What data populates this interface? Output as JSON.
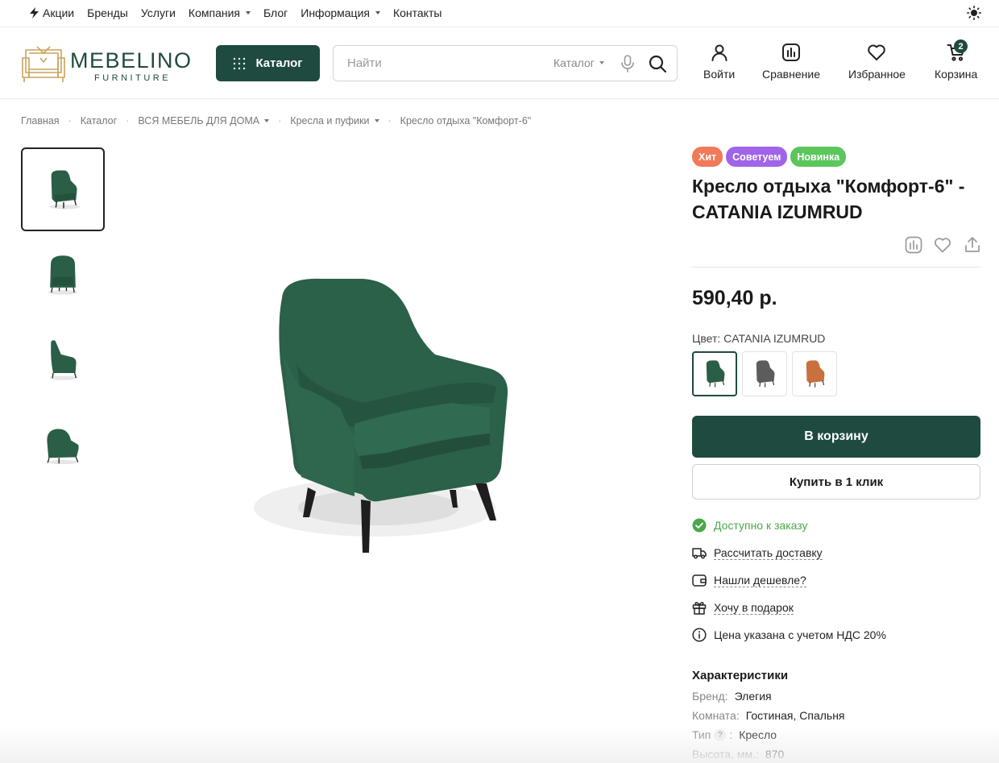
{
  "topnav": {
    "items": [
      {
        "label": "Акции",
        "icon": "lightning-icon"
      },
      {
        "label": "Бренды"
      },
      {
        "label": "Услуги"
      },
      {
        "label": "Компания",
        "has_dropdown": true
      },
      {
        "label": "Блог"
      },
      {
        "label": "Информация",
        "has_dropdown": true
      },
      {
        "label": "Контакты"
      }
    ],
    "theme_icon": "sun-icon"
  },
  "header": {
    "logo": {
      "name": "MEBELINO",
      "subtitle": "FURNITURE"
    },
    "catalog_button": "Каталог",
    "search": {
      "placeholder": "Найти",
      "scope": "Каталог"
    },
    "actions": [
      {
        "label": "Войти",
        "icon": "user-icon"
      },
      {
        "label": "Сравнение",
        "icon": "compare-icon"
      },
      {
        "label": "Избранное",
        "icon": "heart-icon"
      },
      {
        "label": "Корзина",
        "icon": "cart-icon",
        "count": "2"
      }
    ]
  },
  "breadcrumb": [
    {
      "label": "Главная"
    },
    {
      "label": "Каталог"
    },
    {
      "label": "ВСЯ МЕБЕЛЬ ДЛЯ ДОМА",
      "has_dropdown": true
    },
    {
      "label": "Кресла и пуфики",
      "has_dropdown": true
    },
    {
      "label": "Кресло отдыха \"Комфорт-6\""
    }
  ],
  "product": {
    "tags": [
      {
        "label": "Хит",
        "color": "#f07a5a"
      },
      {
        "label": "Советуем",
        "color": "#a064e8"
      },
      {
        "label": "Новинка",
        "color": "#5cc65c"
      }
    ],
    "title": "Кресло отдыха \"Комфорт-6\" - CATANIA IZUMRUD",
    "price": "590,40 р.",
    "color_label": "Цвет: CATANIA IZUMRUD",
    "swatches": [
      {
        "color": "#2a5e47",
        "active": true
      },
      {
        "color": "#5c5c5c",
        "active": false
      },
      {
        "color": "#c9703c",
        "active": false
      }
    ],
    "cart_button": "В корзину",
    "oneclick_button": "Купить в 1 клик",
    "availability": "Доступно к заказу",
    "links": {
      "delivery": "Рассчитать доставку",
      "cheaper": "Нашли дешевле?",
      "gift": "Хочу в подарок"
    },
    "vat_note": "Цена указана с учетом НДС 20%"
  },
  "specs": {
    "title": "Характеристики",
    "rows": [
      {
        "key": "Бренд:",
        "value": "Элегия"
      },
      {
        "key": "Комната:",
        "value": "Гостиная, Спальня"
      },
      {
        "key": "Тип",
        "value": "Кресло",
        "help": "?"
      },
      {
        "key": "Высота, мм.:",
        "value": "870"
      }
    ]
  },
  "colors": {
    "brand": "#1f4a40",
    "chair": "#2a5e47",
    "available": "#4aa84a"
  }
}
